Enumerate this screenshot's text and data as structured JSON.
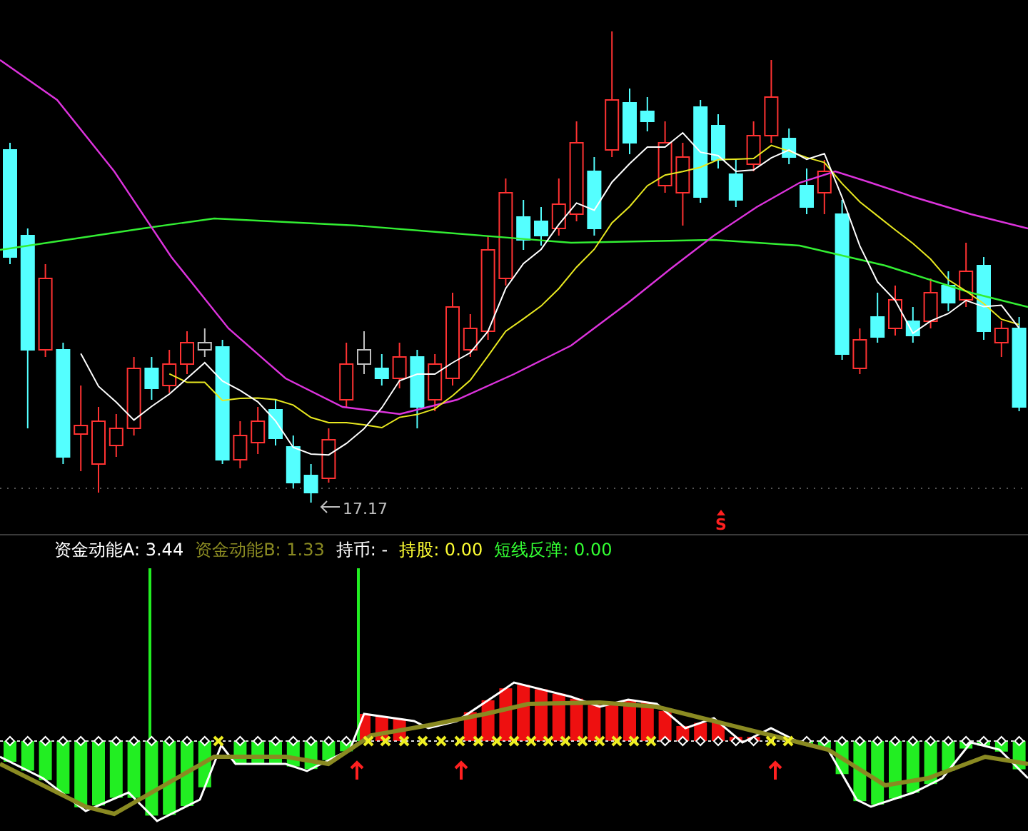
{
  "main_chart": {
    "low_label": "17.17",
    "signal_label": "S"
  },
  "indicator": {
    "legend": [
      {
        "text": "资金动能A: 3.44",
        "color": "#ffffff"
      },
      {
        "text": "资金动能B: 1.33",
        "color": "#8a8a22"
      },
      {
        "text": "持币: -",
        "color": "#ffffff"
      },
      {
        "text": "持股: 0.00",
        "color": "#ffff33"
      },
      {
        "text": "短线反弹: 0.00",
        "color": "#33ff33"
      }
    ]
  }
}
